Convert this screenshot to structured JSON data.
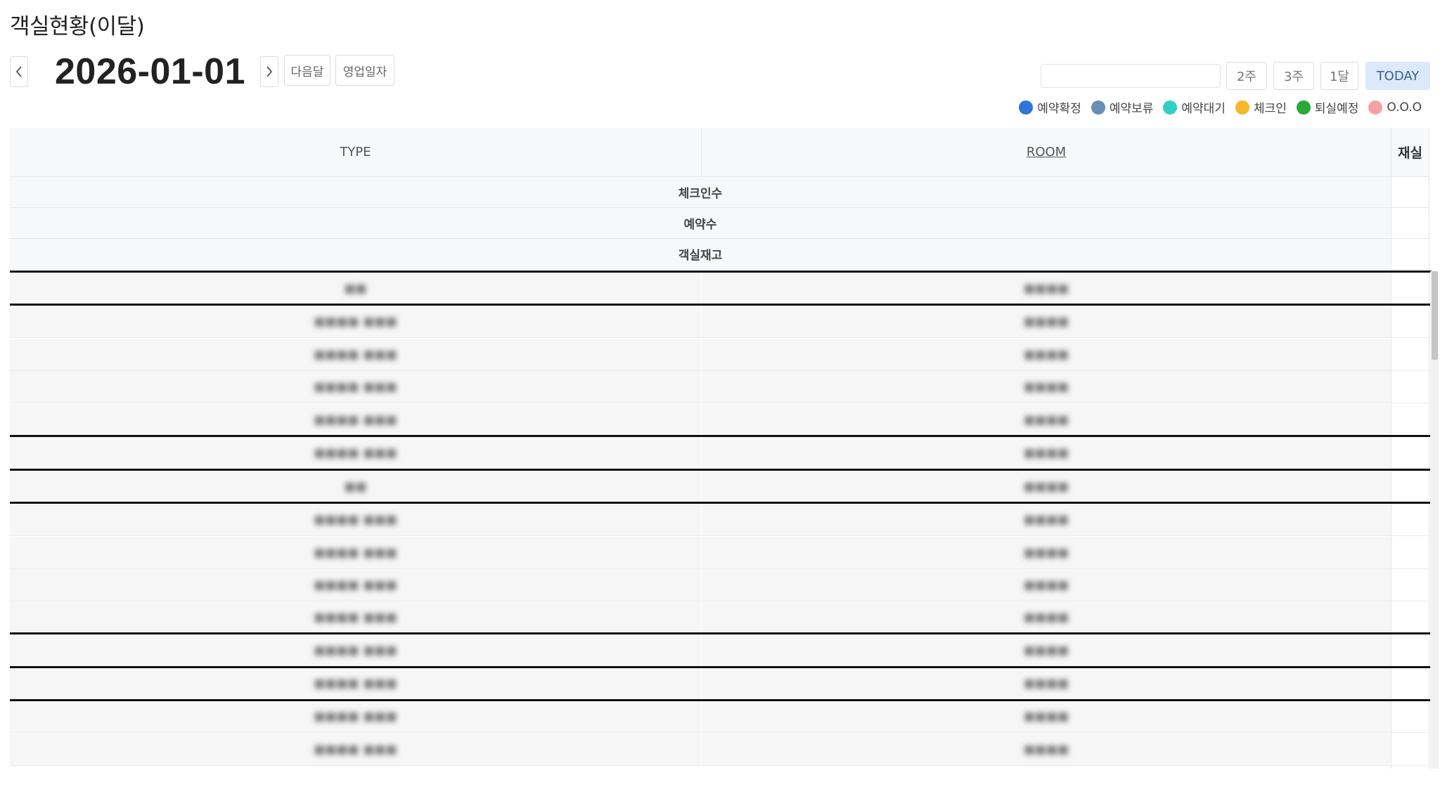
{
  "page": {
    "title": "객실현황(이달)"
  },
  "date_nav": {
    "date": "2026-01-01",
    "next_month_label": "다음달",
    "business_date_label": "영업일자"
  },
  "search": {
    "value": "",
    "placeholder": ""
  },
  "range_buttons": {
    "two_weeks": "2주",
    "three_weeks": "3주",
    "one_month": "1달",
    "today": "TODAY"
  },
  "legend": [
    {
      "label": "예약확정",
      "color": "#2f74d6"
    },
    {
      "label": "예약보류",
      "color": "#6a8db5"
    },
    {
      "label": "예약대기",
      "color": "#32cfc4"
    },
    {
      "label": "체크인",
      "color": "#f7b72b"
    },
    {
      "label": "퇴실예정",
      "color": "#2aa936"
    },
    {
      "label": "O.O.O",
      "color": "#f5a0a5"
    }
  ],
  "table": {
    "headers": {
      "type": "TYPE",
      "room": "ROOM",
      "stay": "재실"
    },
    "summary_rows": [
      "체크인수",
      "예약수",
      "객실재고"
    ],
    "rows": [
      {
        "type": "■■",
        "room": "■■■■"
      },
      {
        "type": "■■■■ ■■■",
        "room": "■■■■"
      },
      {
        "type": "■■■■ ■■■",
        "room": "■■■■"
      },
      {
        "type": "■■■■ ■■■",
        "room": "■■■■"
      },
      {
        "type": "■■■■ ■■■",
        "room": "■■■■"
      },
      {
        "type": "■■■■ ■■■",
        "room": "■■■■"
      },
      {
        "type": "■■",
        "room": "■■■■"
      },
      {
        "type": "■■■■ ■■■",
        "room": "■■■■"
      },
      {
        "type": "■■■■ ■■■",
        "room": "■■■■"
      },
      {
        "type": "■■■■ ■■■",
        "room": "■■■■"
      },
      {
        "type": "■■■■ ■■■",
        "room": "■■■■"
      },
      {
        "type": "■■■■ ■■■",
        "room": "■■■■"
      },
      {
        "type": "■■■■ ■■■",
        "room": "■■■■"
      },
      {
        "type": "■■■■ ■■■",
        "room": "■■■■"
      },
      {
        "type": "■■■■ ■■■",
        "room": "■■■■"
      }
    ]
  }
}
